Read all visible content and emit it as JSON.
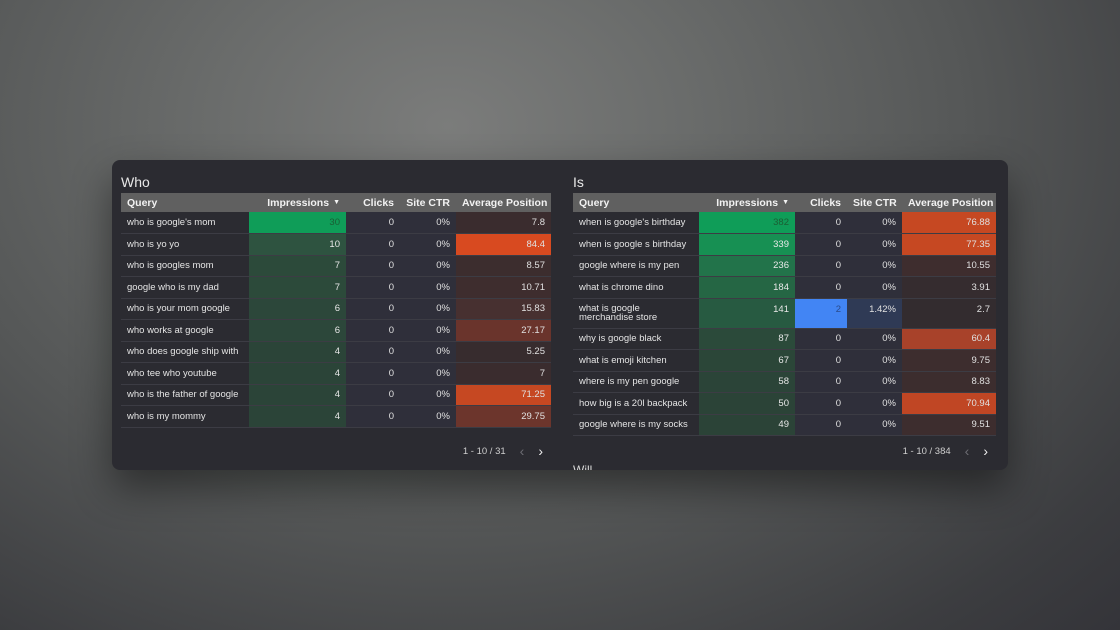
{
  "widgets": [
    {
      "title": "Who",
      "columns": [
        "Query",
        "Impressions",
        "Clicks",
        "Site CTR",
        "Average Position"
      ],
      "sort_column": "Impressions",
      "sort_direction": "descending",
      "rows": [
        {
          "query": "who is google's mom",
          "impressions": "30",
          "clicks": "0",
          "ctr": "0%",
          "avg_position": "7.8",
          "imp_bg": "#0f9d58",
          "imp_fg": "#1b5e34",
          "pos_bg": "#3a2c2e"
        },
        {
          "query": "who is yo yo",
          "impressions": "10",
          "clicks": "0",
          "ctr": "0%",
          "avg_position": "84.4",
          "imp_bg": "#2e5340",
          "imp_fg": "#e8e8e8",
          "pos_bg": "#d84a20"
        },
        {
          "query": "who is googles mom",
          "impressions": "7",
          "clicks": "0",
          "ctr": "0%",
          "avg_position": "8.57",
          "imp_bg": "#2c4a3a",
          "imp_fg": "#e8e8e8",
          "pos_bg": "#3c2d2e"
        },
        {
          "query": "google who is my dad",
          "impressions": "7",
          "clicks": "0",
          "ctr": "0%",
          "avg_position": "10.71",
          "imp_bg": "#2c4a3a",
          "imp_fg": "#e8e8e8",
          "pos_bg": "#3e2d2e"
        },
        {
          "query": "who is your mom google",
          "impressions": "6",
          "clicks": "0",
          "ctr": "0%",
          "avg_position": "15.83",
          "imp_bg": "#2c473a",
          "imp_fg": "#e8e8e8",
          "pos_bg": "#473030"
        },
        {
          "query": "who works at google",
          "impressions": "6",
          "clicks": "0",
          "ctr": "0%",
          "avg_position": "27.17",
          "imp_bg": "#2c473a",
          "imp_fg": "#e8e8e8",
          "pos_bg": "#6a342c"
        },
        {
          "query": "who does google ship with",
          "impressions": "4",
          "clicks": "0",
          "ctr": "0%",
          "avg_position": "5.25",
          "imp_bg": "#2b4438",
          "imp_fg": "#e8e8e8",
          "pos_bg": "#372c2e"
        },
        {
          "query": "who tee who youtube",
          "impressions": "4",
          "clicks": "0",
          "ctr": "0%",
          "avg_position": "7",
          "imp_bg": "#2b4438",
          "imp_fg": "#e8e8e8",
          "pos_bg": "#3a2c2e"
        },
        {
          "query": "who is the father of google",
          "impressions": "4",
          "clicks": "0",
          "ctr": "0%",
          "avg_position": "71.25",
          "imp_bg": "#2b4438",
          "imp_fg": "#e8e8e8",
          "pos_bg": "#c64822"
        },
        {
          "query": "who is my mommy",
          "impressions": "4",
          "clicks": "0",
          "ctr": "0%",
          "avg_position": "29.75",
          "imp_bg": "#2b4438",
          "imp_fg": "#e8e8e8",
          "pos_bg": "#6c352c"
        }
      ],
      "pagination": "1 - 10 / 31"
    },
    {
      "title": "Is",
      "columns": [
        "Query",
        "Impressions",
        "Clicks",
        "Site CTR",
        "Average Position"
      ],
      "sort_column": "Impressions",
      "sort_direction": "descending",
      "rows": [
        {
          "query": "when is google's birthday",
          "impressions": "382",
          "clicks": "0",
          "ctr": "0%",
          "avg_position": "76.88",
          "imp_bg": "#0f9d58",
          "imp_fg": "#1b5e34",
          "pos_bg": "#c64822"
        },
        {
          "query": "when is google s birthday",
          "impressions": "339",
          "clicks": "0",
          "ctr": "0%",
          "avg_position": "77.35",
          "imp_bg": "#179053",
          "imp_fg": "#e8e8e8",
          "pos_bg": "#c64822"
        },
        {
          "query": "google where is my pen",
          "impressions": "236",
          "clicks": "0",
          "ctr": "0%",
          "avg_position": "10.55",
          "imp_bg": "#22734a",
          "imp_fg": "#e8e8e8",
          "pos_bg": "#3e2d2e"
        },
        {
          "query": "what is chrome dino",
          "impressions": "184",
          "clicks": "0",
          "ctr": "0%",
          "avg_position": "3.91",
          "imp_bg": "#256644",
          "imp_fg": "#e8e8e8",
          "pos_bg": "#352c2f"
        },
        {
          "query": "what is google merchandise store",
          "impressions": "141",
          "clicks": "2",
          "ctr": "1.42%",
          "avg_position": "2.7",
          "imp_bg": "#275a41",
          "imp_fg": "#e8e8e8",
          "pos_bg": "#332c2f",
          "clicks_bg": "#4285f4",
          "clicks_fg": "#2a4a8a",
          "ctr_bg": "#2f3a55",
          "tall": true
        },
        {
          "query": "why is google black",
          "impressions": "87",
          "clicks": "0",
          "ctr": "0%",
          "avg_position": "60.4",
          "imp_bg": "#2b4a3a",
          "imp_fg": "#e8e8e8",
          "pos_bg": "#a8422a"
        },
        {
          "query": "what is emoji kitchen",
          "impressions": "67",
          "clicks": "0",
          "ctr": "0%",
          "avg_position": "9.75",
          "imp_bg": "#2b4638",
          "imp_fg": "#e8e8e8",
          "pos_bg": "#3d2d2e"
        },
        {
          "query": "where is my pen google",
          "impressions": "58",
          "clicks": "0",
          "ctr": "0%",
          "avg_position": "8.83",
          "imp_bg": "#2b4438",
          "imp_fg": "#e8e8e8",
          "pos_bg": "#3c2d2e"
        },
        {
          "query": "how big is a 20l backpack",
          "impressions": "50",
          "clicks": "0",
          "ctr": "0%",
          "avg_position": "70.94",
          "imp_bg": "#2b4337",
          "imp_fg": "#e8e8e8",
          "pos_bg": "#c04624"
        },
        {
          "query": "google where is my socks",
          "impressions": "49",
          "clicks": "0",
          "ctr": "0%",
          "avg_position": "9.51",
          "imp_bg": "#2b4337",
          "imp_fg": "#e8e8e8",
          "pos_bg": "#3d2d2e"
        }
      ],
      "pagination": "1 - 10 / 384"
    }
  ],
  "next_widget_title": "Will",
  "icons": {
    "sort": "▼",
    "prev": "‹",
    "next": "›"
  }
}
